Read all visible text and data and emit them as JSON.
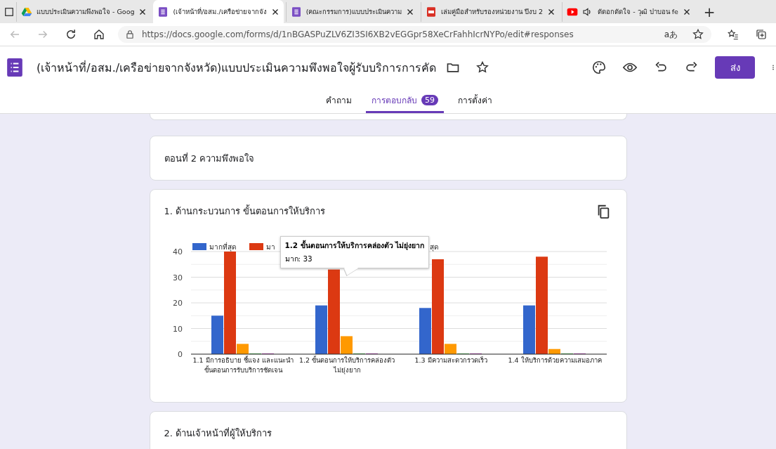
{
  "browser": {
    "tabs": [
      {
        "kind": "drive",
        "title": "แบบประเมินความพึงพอใจ - Goog",
        "selected": false
      },
      {
        "kind": "form",
        "title": "(เจ้าหน้าที่/อสม./เครือข่ายจากจัง",
        "selected": true
      },
      {
        "kind": "form",
        "title": "(คณะกรรมการ)แบบประเมินความ",
        "selected": false
      },
      {
        "kind": "pdf",
        "title": "เล่มคู่มือสำหรับรองหน่วยงาน ปีงบ 2",
        "selected": false
      },
      {
        "kind": "video",
        "title": "ตัดอกตัดใจ - วุฒิ ปาบอน fe",
        "selected": false
      }
    ],
    "new_tab": "+",
    "url": "https://docs.google.com/forms/d/1nBGASPuZLV6ZI3SI6XB2vEGGpr58XeCrFahhIcrNYPo/edit#responses",
    "read_aloud": "aあ"
  },
  "form": {
    "title": "(เจ้าหน้าที่/อสม./เครือข่ายจากจังหวัด)แบบประเมินความพึงพอใจผู้รับบริการการคัด",
    "send_button": "ส่ง",
    "tabs": [
      {
        "label": "คำถาม",
        "selected": false
      },
      {
        "label": "การตอบกลับ",
        "selected": true,
        "badge": "59"
      },
      {
        "label": "การตั้งค่า",
        "selected": false
      }
    ]
  },
  "sections": [
    {
      "kind": "header",
      "title": "ตอนที่ 2 ความพึงพอใจ"
    },
    {
      "kind": "chart",
      "title": "1. ด้านกระบวนการ ขั้นตอนการให้บริการ",
      "legend": [
        "มากที่สุด",
        "มา",
        "สุด"
      ],
      "tooltip": {
        "title": "1.2 ขั้นตอนการให้บริการคล่องตัว ไม่ยุ่งยาก",
        "line": "มาก: 33"
      },
      "chart_data": {
        "type": "bar",
        "categories": [
          "1.1 มีการอธิบาย ชี้แจง และแนะนำขั้นตอนการรับบริการชัดเจน",
          "1.2 ขั้นตอนการให้บริการคล่องตัว ไม่ยุ่งยาก",
          "1.3 มีความสะดวกรวดเร็ว",
          "1.4 ให้บริการด้วยความเสมอภาค"
        ],
        "ylim": [
          0,
          40
        ],
        "yticks": [
          0,
          10,
          20,
          30,
          40
        ],
        "grid": true,
        "series": [
          {
            "color": "#3366cc",
            "values": [
              15,
              19,
              18,
              19
            ]
          },
          {
            "color": "#dc3912",
            "values": [
              40,
              33,
              37,
              38
            ]
          },
          {
            "color": "#ff9900",
            "values": [
              4,
              7,
              4,
              2
            ]
          },
          {
            "color": "#109618",
            "values": [
              0,
              0,
              0,
              0
            ]
          },
          {
            "color": "#990099",
            "values": [
              0,
              0,
              0,
              0
            ]
          }
        ]
      }
    },
    {
      "kind": "chart",
      "title": "2. ด้านเจ้าหน้าที่ผู้ให้บริการ"
    }
  ]
}
